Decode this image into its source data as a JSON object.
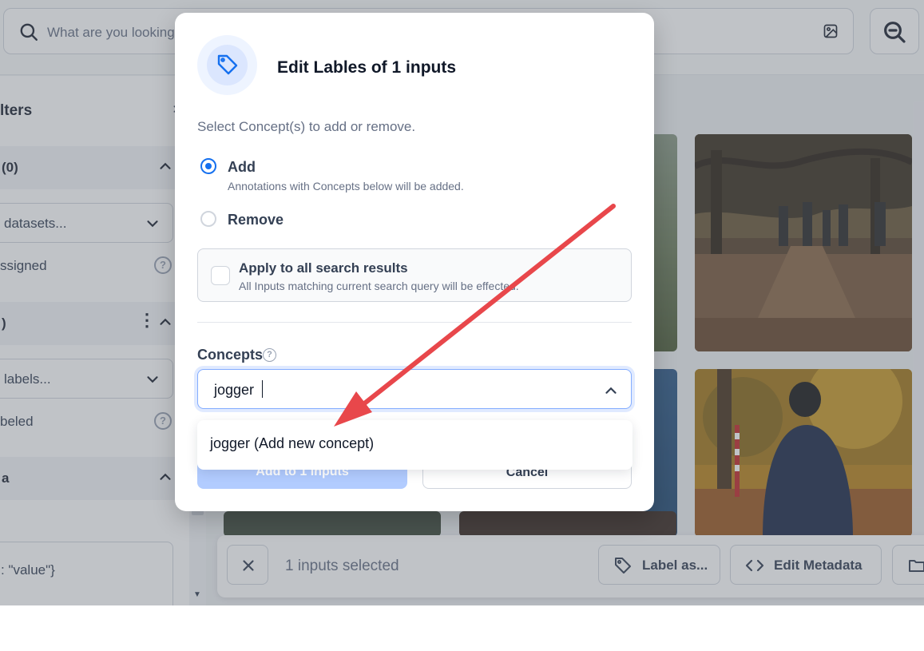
{
  "search": {
    "placeholder": "What are you looking"
  },
  "sidebar": {
    "filters_title": "lters",
    "close_glyph": "×",
    "datasets_section_title": "(0)",
    "datasets_select": "datasets...",
    "unassigned_label": "ssigned",
    "labels_section_title": ")",
    "labels_select": "labels...",
    "unlabeled_label": "beled",
    "metadata_section_title": "a",
    "metadata_value": ": \"value\"}",
    "help_glyph": "?"
  },
  "bottom_bar": {
    "selected_text": "1 inputs selected",
    "label_as": "Label as...",
    "edit_metadata": "Edit Metadata"
  },
  "modal": {
    "title": "Edit Lables of 1 inputs",
    "subtitle": "Select Concept(s) to add or remove.",
    "add_label": "Add",
    "add_desc": "Annotations with Concepts below will be added.",
    "remove_label": "Remove",
    "apply_label": "Apply to all search results",
    "apply_desc": "All Inputs matching current search query will be effected.",
    "concepts_label": "Concepts",
    "concepts_help": "?",
    "concepts_value": "jogger",
    "dropdown_option": "jogger (Add new concept)",
    "add_button": "Add to 1 inputs",
    "cancel_button": "Cancel",
    "selected_mode": "Add"
  },
  "colors": {
    "accent": "#1570ef",
    "annotation_arrow": "#e8474b",
    "disabled_button": "#b2ccff"
  }
}
